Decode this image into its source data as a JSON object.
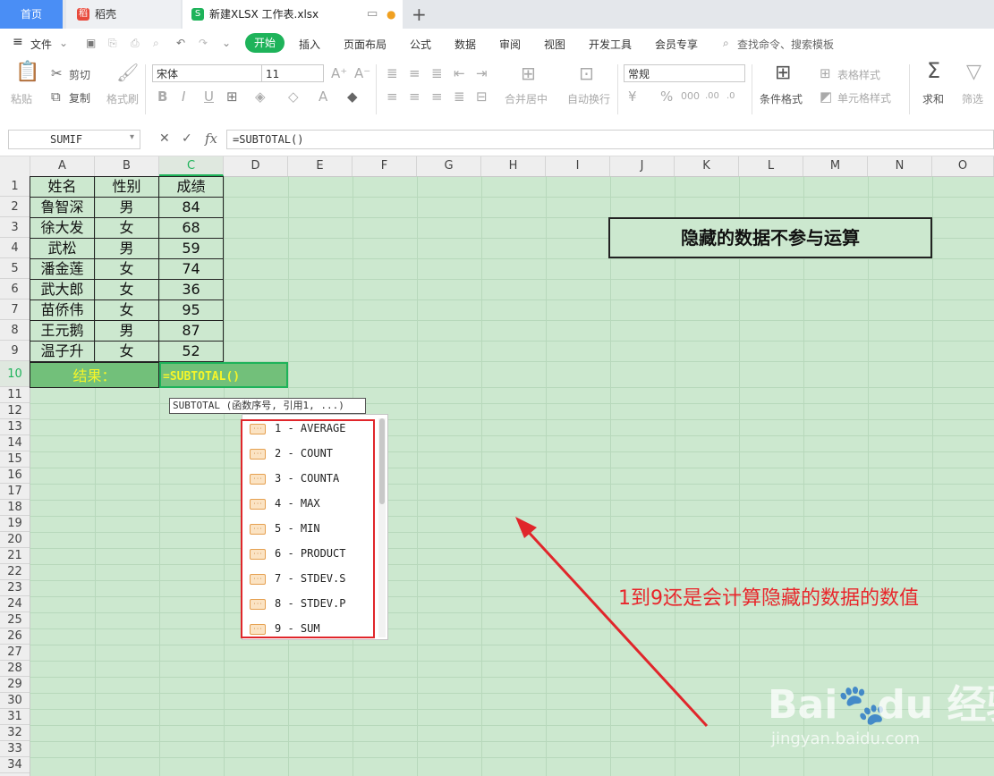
{
  "tabs": {
    "home": "首页",
    "docer": "稻壳",
    "file": "新建XLSX 工作表.xlsx"
  },
  "menu": {
    "file": "文件",
    "items": [
      "开始",
      "插入",
      "页面布局",
      "公式",
      "数据",
      "审阅",
      "视图",
      "开发工具",
      "会员专享"
    ],
    "search": "查找命令、搜索模板"
  },
  "ribbon": {
    "paste": "粘贴",
    "cut": "剪切",
    "copy": "复制",
    "format_painter": "格式刷",
    "font_name": "宋体",
    "font_size": "11",
    "number_format": "常规",
    "merge_center": "合并居中",
    "wrap_text": "自动换行",
    "cond_format": "条件格式",
    "table_style": "表格样式",
    "cell_style": "单元格样式",
    "sum": "求和",
    "filter": "筛选"
  },
  "formula_bar": {
    "name_box": "SUMIF",
    "fx": "fx",
    "formula": "=SUBTOTAL()"
  },
  "columns": [
    "A",
    "B",
    "C",
    "D",
    "E",
    "F",
    "G",
    "H",
    "I",
    "J",
    "K",
    "L",
    "M",
    "N",
    "O"
  ],
  "rows": [
    "1",
    "2",
    "3",
    "4",
    "5",
    "6",
    "7",
    "8",
    "9",
    "10",
    "11",
    "12",
    "13",
    "14",
    "15",
    "16",
    "17",
    "18",
    "19",
    "20",
    "21",
    "22",
    "23",
    "24",
    "25",
    "26",
    "27",
    "28",
    "29",
    "30",
    "31",
    "32",
    "33",
    "34"
  ],
  "table": {
    "headers": [
      "姓名",
      "性别",
      "成绩"
    ],
    "rows": [
      [
        "鲁智深",
        "男",
        "84"
      ],
      [
        "徐大发",
        "女",
        "68"
      ],
      [
        "武松",
        "男",
        "59"
      ],
      [
        "潘金莲",
        "女",
        "74"
      ],
      [
        "武大郎",
        "女",
        "36"
      ],
      [
        "苗侨伟",
        "女",
        "95"
      ],
      [
        "王元鹅",
        "男",
        "87"
      ],
      [
        "温子升",
        "女",
        "52"
      ]
    ],
    "result_label": "结果：",
    "result_formula": "=SUBTOTAL()"
  },
  "tooltip": "SUBTOTAL (函数序号, 引用1, ...)",
  "dropdown": [
    "1 - AVERAGE",
    "2 - COUNT",
    "3 - COUNTA",
    "4 - MAX",
    "5 - MIN",
    "6 - PRODUCT",
    "7 - STDEV.S",
    "8 - STDEV.P",
    "9 - SUM"
  ],
  "annotations": {
    "hidden_note": "隐藏的数据不参与运算",
    "red_note": "1到9还是会计算隐藏的数据的数值"
  },
  "watermark": {
    "logo": "Bai du 经验",
    "url": "jingyan.baidu.com"
  },
  "colors": {
    "sheet_bg": "#cce8cf",
    "accent_green": "#1eb35a",
    "annotation_red": "#e0262b",
    "result_row": "#72c07a",
    "result_text": "#f5f52a"
  }
}
